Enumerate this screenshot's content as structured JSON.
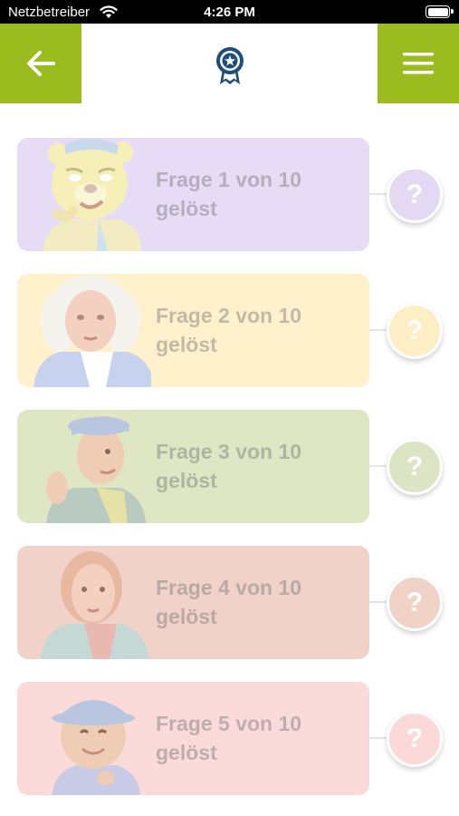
{
  "status_bar": {
    "carrier": "Netzbetreiber",
    "time": "4:26 PM"
  },
  "header": {
    "back_icon": "arrow-left-icon",
    "center_icon": "award-badge-icon",
    "menu_icon": "hamburger-menu-icon",
    "accent_color": "#9cbb1f",
    "badge_color": "#1f4f78"
  },
  "questions": [
    {
      "label": "Frage 1 von 10 gelöst",
      "symbol": "?",
      "card_color": "#e6dcf6",
      "button_color": "#e3d9f3"
    },
    {
      "label": "Frage 2 von 10 gelöst",
      "symbol": "?",
      "card_color": "#fff1cc",
      "button_color": "#fdeec5"
    },
    {
      "label": "Frage 3 von 10 gelöst",
      "symbol": "?",
      "card_color": "#dfe6c4",
      "button_color": "#dde4c3"
    },
    {
      "label": "Frage 4 von 10 gelöst",
      "symbol": "?",
      "card_color": "#f0d2c9",
      "button_color": "#f0d2c7"
    },
    {
      "label": "Frage 5 von 10 gelöst",
      "symbol": "?",
      "card_color": "#fbdada",
      "button_color": "#fad9d8"
    }
  ]
}
